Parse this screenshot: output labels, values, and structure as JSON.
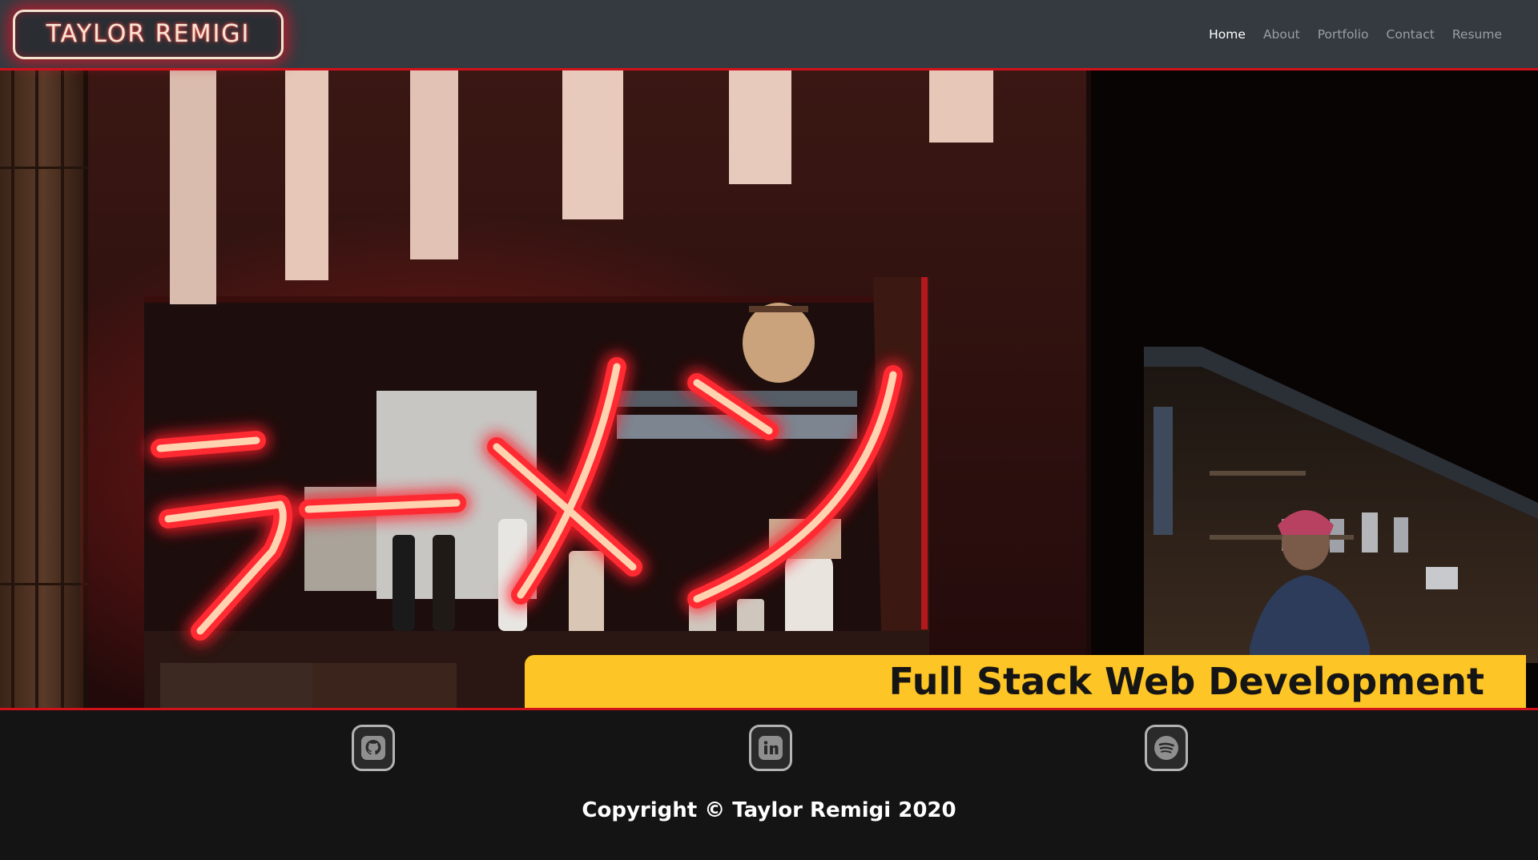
{
  "brand": {
    "name": "TAYLOR REMIGI"
  },
  "nav": {
    "items": [
      {
        "label": "Home",
        "active": true
      },
      {
        "label": "About",
        "active": false
      },
      {
        "label": "Portfolio",
        "active": false
      },
      {
        "label": "Contact",
        "active": false
      },
      {
        "label": "Resume",
        "active": false
      }
    ]
  },
  "hero": {
    "title": "Full Stack Web Development",
    "neon_sign_text": "ラーメン",
    "banner_color": "#fec526",
    "image_description_icon": "ramen-shop-photo"
  },
  "social": [
    {
      "name": "github",
      "icon": "github-icon"
    },
    {
      "name": "linkedin",
      "icon": "linkedin-icon"
    },
    {
      "name": "spotify",
      "icon": "spotify-icon"
    }
  ],
  "footer": {
    "copyright": "Copyright © Taylor Remigi 2020"
  },
  "colors": {
    "navbar_bg": "#343a40",
    "accent_red": "#d0121b",
    "footer_bg": "#141414"
  }
}
